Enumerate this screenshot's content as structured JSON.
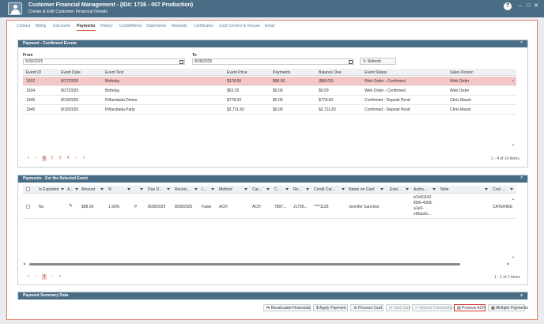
{
  "window": {
    "title": "Customer Financial Management - (ID#: 1726 - 007 Production)",
    "subtitle": "Create & Edit Customer Financial Details",
    "help": "?",
    "minimize": "–",
    "maximize": "□",
    "close": "✕"
  },
  "tabs": [
    "Contact",
    "Billing",
    "Discounts",
    "Payments",
    "History",
    "Credit/Memo",
    "Statements",
    "Rewards",
    "Certificates",
    "Cost Centers & Venues",
    "Email"
  ],
  "active_tab": "Payments",
  "confirmed": {
    "title": "Payment - Confirmed Events",
    "collapse": "^",
    "from_label": "From",
    "from_value": "5/30/2025",
    "to_label": "To",
    "to_value": "8/28/2025",
    "refresh": "Refresh",
    "columns": [
      "Event ID",
      "Event Date",
      "Event Text",
      "Event Price",
      "Payments",
      "Balance Due",
      "Event Status",
      "Sales Person"
    ],
    "rows": [
      [
        "1932",
        "8/27/2025",
        "Birthday",
        "$178.59",
        "$98.00",
        "($98.00)",
        "Web Order - Confirmed",
        "Web Order"
      ],
      [
        "1934",
        "8/27/2025",
        "Birthday",
        "$63.25",
        "$0.00",
        "$0.00",
        "Web Order - Confirmed",
        "Web Order"
      ],
      [
        "1946",
        "8/19/2025",
        "Piñacolada Dinner",
        "$778.03",
        "$0.00",
        "$778.03",
        "Confirmed - Deposit Pend",
        "Chris Marsh"
      ],
      [
        "1945",
        "8/18/2025",
        "Piñacolada Party",
        "$2,711.82",
        "$0.00",
        "$2,711.82",
        "Confirmed - Deposit Pend",
        "Chris Marsh"
      ]
    ],
    "pages": [
      "1",
      "2",
      "3",
      "4"
    ],
    "pager_nav": [
      "«",
      "‹",
      "›",
      "»"
    ],
    "page_info": "1 - 4 of 14 items"
  },
  "payments": {
    "title": "Payments - For the Selected Event",
    "collapse": "^",
    "columns": [
      "Is Exported",
      "A...",
      "Amount",
      "%",
      "",
      "Due D...",
      "Receiv...",
      "L...",
      "Method",
      "Car...",
      "C...",
      "Re...",
      "Credit Car...",
      "Name on Card",
      "Expi...",
      "Autho...",
      "Note",
      "Cost ..."
    ],
    "row": {
      "exported": "No",
      "amount": "$98.00",
      "percent": "1.93%",
      "type": "P",
      "due": "8/28/2025",
      "received": "8/28/2025",
      "l": "False",
      "method": "ACH",
      "car": "ACH",
      "c": "7897...",
      "re": "J1756...",
      "credit_card": "****1126",
      "name": "Jennifer Sanchez",
      "auth": [
        "b7e50242-",
        "f096-4359-",
        "a1e3-",
        "e9faceb..."
      ],
      "cost": "CATERING"
    },
    "pages": [
      "1"
    ],
    "pager_nav": [
      "«",
      "‹",
      "›",
      "»"
    ],
    "page_info": "1 - 1 of 1 items"
  },
  "summary": {
    "title": "Payment Summary Data",
    "collapse": "v"
  },
  "actions": [
    "Recalculate Financials",
    "Apply Payment",
    "Process Card",
    "Void Card",
    "Refund Transaction",
    "Process ACH",
    "Multiple Payments"
  ]
}
